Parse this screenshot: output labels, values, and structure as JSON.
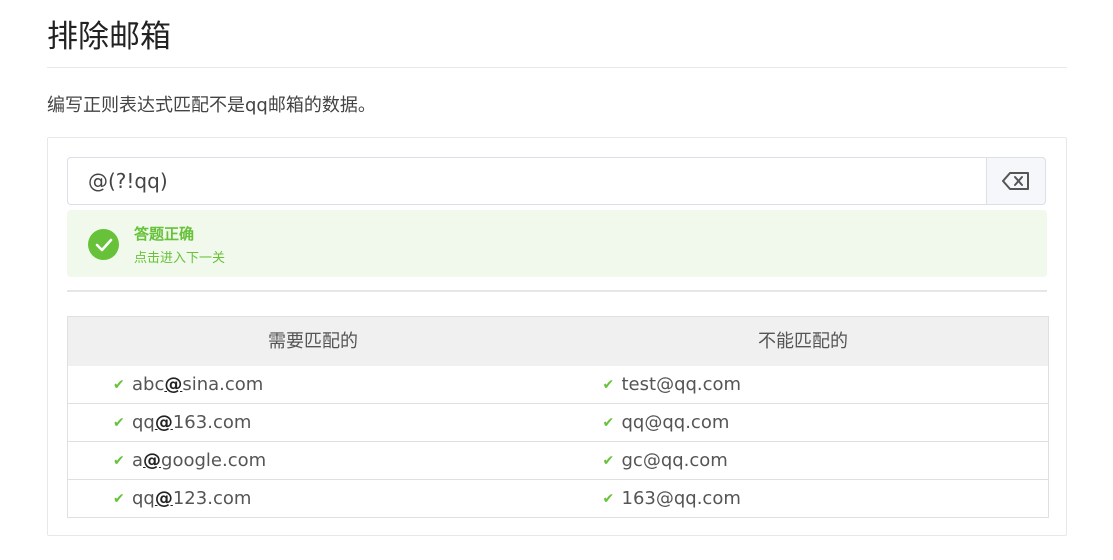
{
  "page": {
    "title": "排除邮箱",
    "description": "编写正则表达式匹配不是qq邮箱的数据。"
  },
  "input": {
    "value": "@(?!qq)"
  },
  "result": {
    "title": "答题正确",
    "subtitle": "点击进入下一关",
    "status_color": "#67c23a"
  },
  "cases": {
    "headers": [
      "需要匹配的",
      "不能匹配的"
    ],
    "match": [
      {
        "pre": "abc",
        "hit": "@",
        "post": "sina.com"
      },
      {
        "pre": "qq",
        "hit": "@",
        "post": "163.com"
      },
      {
        "pre": "a",
        "hit": "@",
        "post": "google.com"
      },
      {
        "pre": "qq",
        "hit": "@",
        "post": "123.com"
      }
    ],
    "no_match": [
      "test@qq.com",
      "qq@qq.com",
      "gc@qq.com",
      "163@qq.com"
    ]
  },
  "icons": {
    "clear": "backspace-icon",
    "success": "check-circle-icon",
    "row": "check-icon"
  }
}
